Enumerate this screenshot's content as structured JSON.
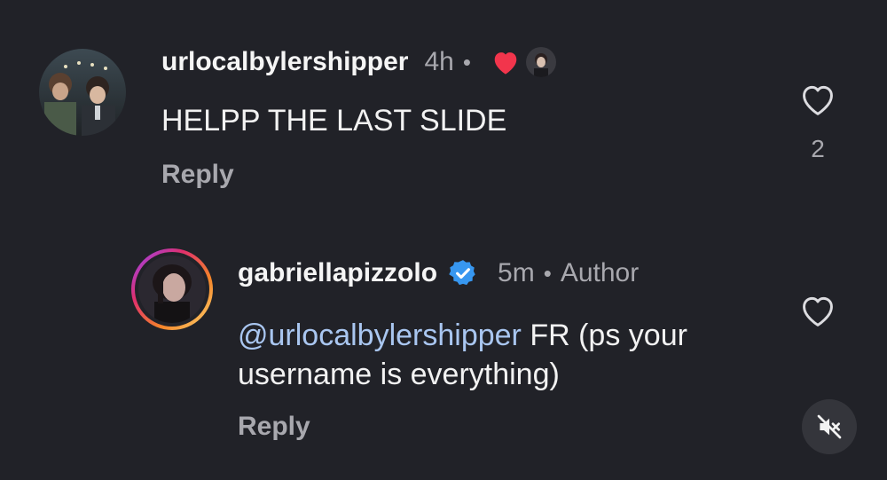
{
  "comments": [
    {
      "username": "urlocalbylershipper",
      "time": "4h",
      "separator": "•",
      "text": "HELPP THE LAST SLIDE",
      "reply_label": "Reply",
      "like_count": "2",
      "liked_by_author": true
    },
    {
      "username": "gabriellapizzolo",
      "verified": true,
      "time": "5m",
      "separator": "•",
      "author_label": "Author",
      "mention": "@urlocalbylershipper",
      "text_line1": " FR (ps your",
      "text_line2": "username is everything)",
      "reply_label": "Reply"
    }
  ],
  "colors": {
    "background": "#212228",
    "liked_heart": "#f2354c",
    "verified_badge": "#3797f0",
    "mention": "#a9c6f0",
    "muted_text": "#a8a8ae"
  },
  "icons": {
    "like": "heart-outline-icon",
    "liked": "heart-filled-icon",
    "verified": "verified-badge-icon",
    "mute": "speaker-muted-icon"
  }
}
